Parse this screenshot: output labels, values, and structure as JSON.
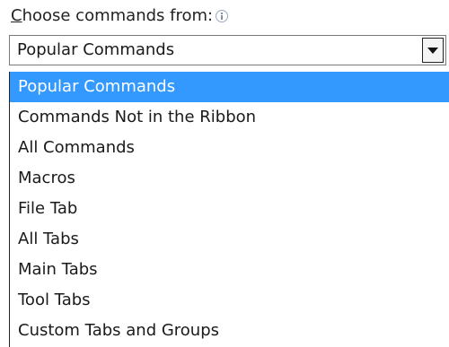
{
  "label": {
    "accel_char": "C",
    "rest": "hoose commands from:",
    "info_icon": "info-icon"
  },
  "combo": {
    "value": "Popular Commands",
    "arrow_icon": "chevron-down-icon"
  },
  "options": [
    {
      "label": "Popular Commands",
      "selected": true
    },
    {
      "label": "Commands Not in the Ribbon",
      "selected": false
    },
    {
      "label": "All Commands",
      "selected": false
    },
    {
      "label": "Macros",
      "selected": false
    },
    {
      "label": "File Tab",
      "selected": false
    },
    {
      "label": "All Tabs",
      "selected": false
    },
    {
      "label": "Main Tabs",
      "selected": false
    },
    {
      "label": "Tool Tabs",
      "selected": false
    },
    {
      "label": "Custom Tabs and Groups",
      "selected": false
    }
  ],
  "colors": {
    "selection": "#3399ff",
    "selection_text": "#ffffff"
  }
}
